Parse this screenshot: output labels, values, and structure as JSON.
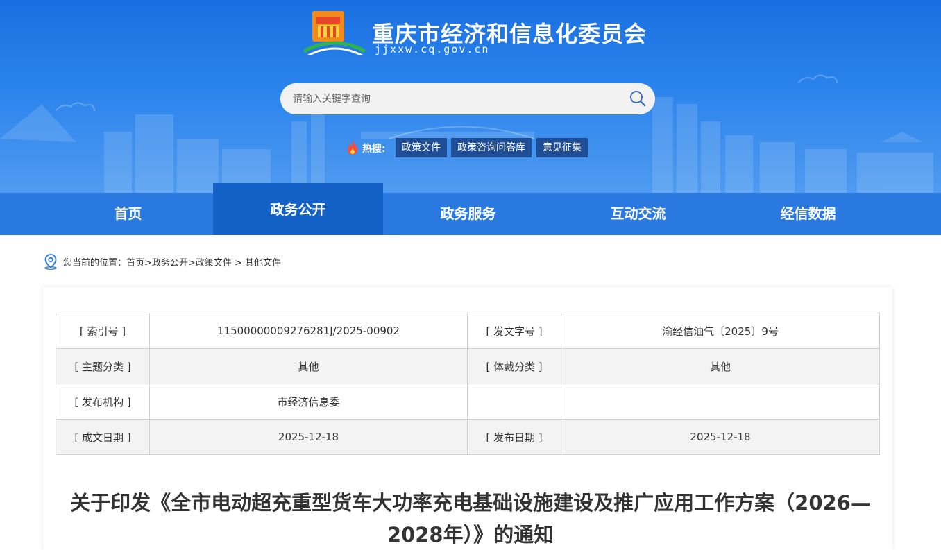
{
  "header": {
    "site_title": "重庆市经济和信息化委员会",
    "site_domain": "jjxxw.cq.gov.cn"
  },
  "search": {
    "placeholder": "请输入关键字查询"
  },
  "hot_search": {
    "label": "热搜:",
    "tags": [
      "政策文件",
      "政策咨询问答库",
      "意见征集"
    ]
  },
  "nav": {
    "items": [
      "首页",
      "政务公开",
      "政务服务",
      "互动交流",
      "经信数据"
    ],
    "active_index": 1
  },
  "breadcrumb": {
    "prefix": "您当前的位置：",
    "path": "首页>政务公开>政策文件 > 其他文件"
  },
  "meta_table": {
    "rows": [
      [
        "[ 索引号 ]",
        "11500000009276281J/2025-00902",
        "[ 发文字号 ]",
        "渝经信油气〔2025〕9号"
      ],
      [
        "[ 主题分类 ]",
        "其他",
        "[ 体裁分类 ]",
        "其他"
      ],
      [
        "[ 发布机构 ]",
        "市经济信息委",
        "",
        ""
      ],
      [
        "[ 成文日期 ]",
        "2025-12-18",
        "[ 发布日期 ]",
        "2025-12-18"
      ]
    ]
  },
  "document": {
    "title": "关于印发《全市电动超充重型货车大功率充电基础设施建设及推广应用工作方案（2026—2028年）》的通知"
  },
  "colors": {
    "banner": "#2a83ec",
    "nav": "#2979e0",
    "nav_active": "#1361c6",
    "hot_tag": "#1f4e96"
  }
}
